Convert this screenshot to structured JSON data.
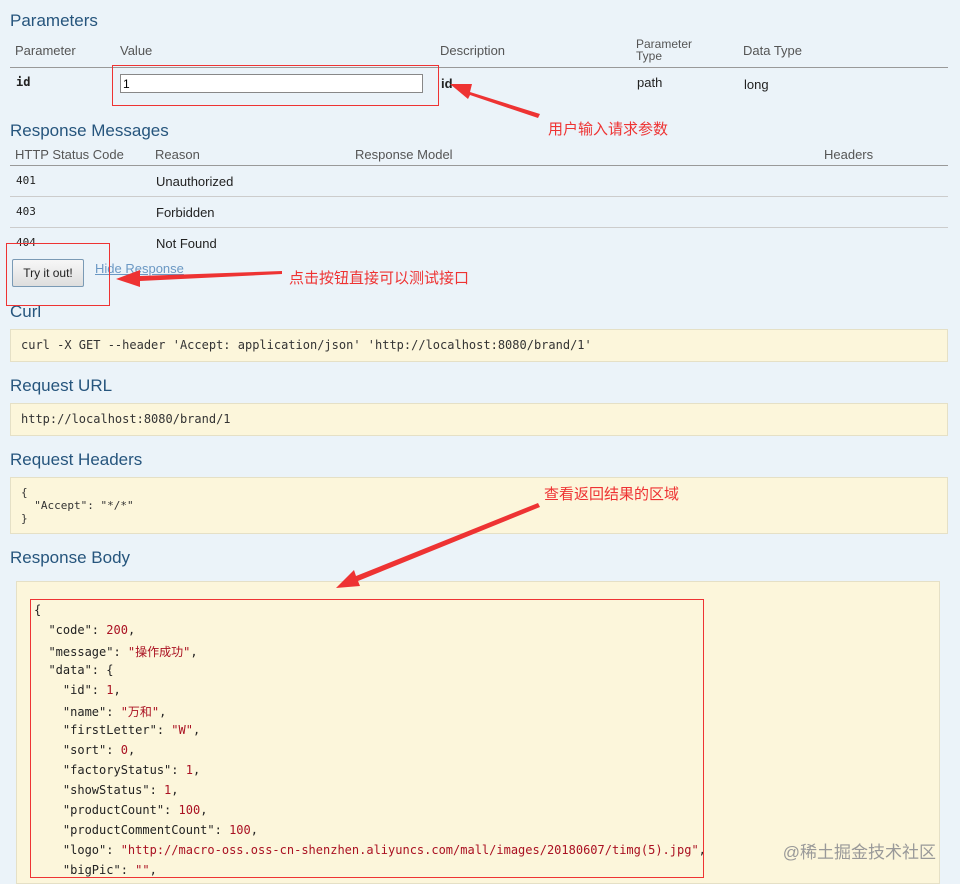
{
  "parameters": {
    "title": "Parameters",
    "headers": {
      "parameter": "Parameter",
      "value": "Value",
      "description": "Description",
      "param_type_line1": "Parameter",
      "param_type_line2": "Type",
      "data_type": "Data Type"
    },
    "row": {
      "name": "id",
      "value": "1",
      "description": "id",
      "type": "path",
      "data_type": "long"
    }
  },
  "response_messages": {
    "title": "Response Messages",
    "headers": {
      "code": "HTTP Status Code",
      "reason": "Reason",
      "model": "Response Model",
      "headers": "Headers"
    },
    "rows": [
      {
        "code": "401",
        "reason": "Unauthorized"
      },
      {
        "code": "403",
        "reason": "Forbidden"
      },
      {
        "code": "404",
        "reason": "Not Found"
      }
    ]
  },
  "actions": {
    "try_label": "Try it out!",
    "hide_label": "Hide Response"
  },
  "curl": {
    "title": "Curl",
    "command": "curl -X GET --header 'Accept: application/json' 'http://localhost:8080/brand/1'"
  },
  "request_url": {
    "title": "Request URL",
    "url": "http://localhost:8080/brand/1"
  },
  "request_headers": {
    "title": "Request Headers",
    "lines": [
      "{",
      "  \"Accept\": \"*/*\"",
      "}"
    ]
  },
  "response_body": {
    "title": "Response Body",
    "lines": [
      "{",
      "  \"code\": 200,",
      "  \"message\": \"操作成功\",",
      "  \"data\": {",
      "    \"id\": 1,",
      "    \"name\": \"万和\",",
      "    \"firstLetter\": \"W\",",
      "    \"sort\": 0,",
      "    \"factoryStatus\": 1,",
      "    \"showStatus\": 1,",
      "    \"productCount\": 100,",
      "    \"productCommentCount\": 100,",
      "    \"logo\": \"http://macro-oss.oss-cn-shenzhen.aliyuncs.com/mall/images/20180607/timg(5).jpg\",",
      "    \"bigPic\": \"\","
    ]
  },
  "annotations": {
    "input_note": "用户输入请求参数",
    "button_note": "点击按钮直接可以测试接口",
    "result_note": "查看返回结果的区域"
  },
  "watermark": "@稀土掘金技术社区",
  "colors": {
    "annotation": "#ee3333",
    "heading": "#26557d",
    "code_bg": "#fcf6db",
    "page_bg": "#ebf3f9"
  }
}
